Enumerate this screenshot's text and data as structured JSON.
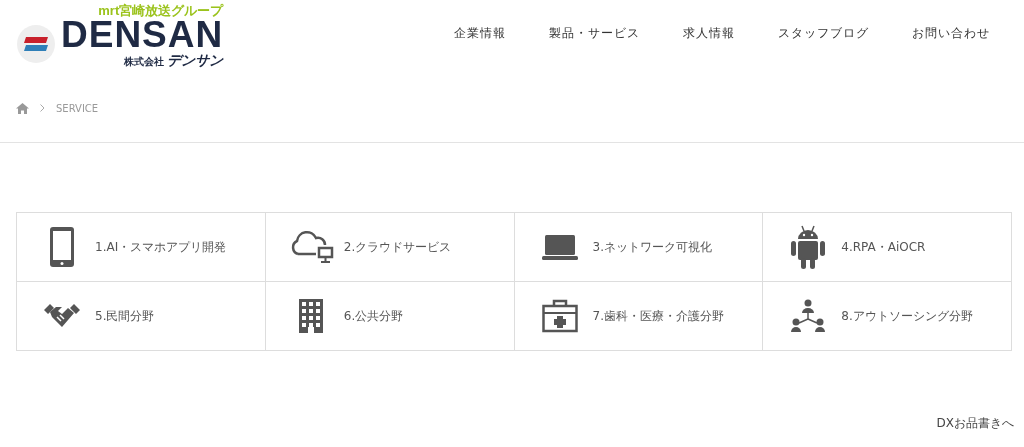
{
  "logo": {
    "group": "mrt宮崎放送グループ",
    "name": "DENSAN",
    "company_type": "株式会社",
    "company_kana": "デンサン"
  },
  "nav": [
    "企業情報",
    "製品・サービス",
    "求人情報",
    "スタッフブログ",
    "お問い合わせ"
  ],
  "breadcrumb": {
    "current": "SERVICE"
  },
  "services": [
    {
      "kind": "tablet",
      "label": "1.AI・スマホアプリ開発"
    },
    {
      "kind": "cloud",
      "label": "2.クラウドサービス"
    },
    {
      "kind": "laptop",
      "label": "3.ネットワーク可視化"
    },
    {
      "kind": "robot",
      "label": "4.RPA・AiOCR"
    },
    {
      "kind": "handshake",
      "label": "5.民間分野"
    },
    {
      "kind": "building",
      "label": "6.公共分野"
    },
    {
      "kind": "medical",
      "label": "7.歯科・医療・介護分野"
    },
    {
      "kind": "people",
      "label": "8.アウトソーシング分野"
    }
  ],
  "footer_link": "DXお品書きへ"
}
